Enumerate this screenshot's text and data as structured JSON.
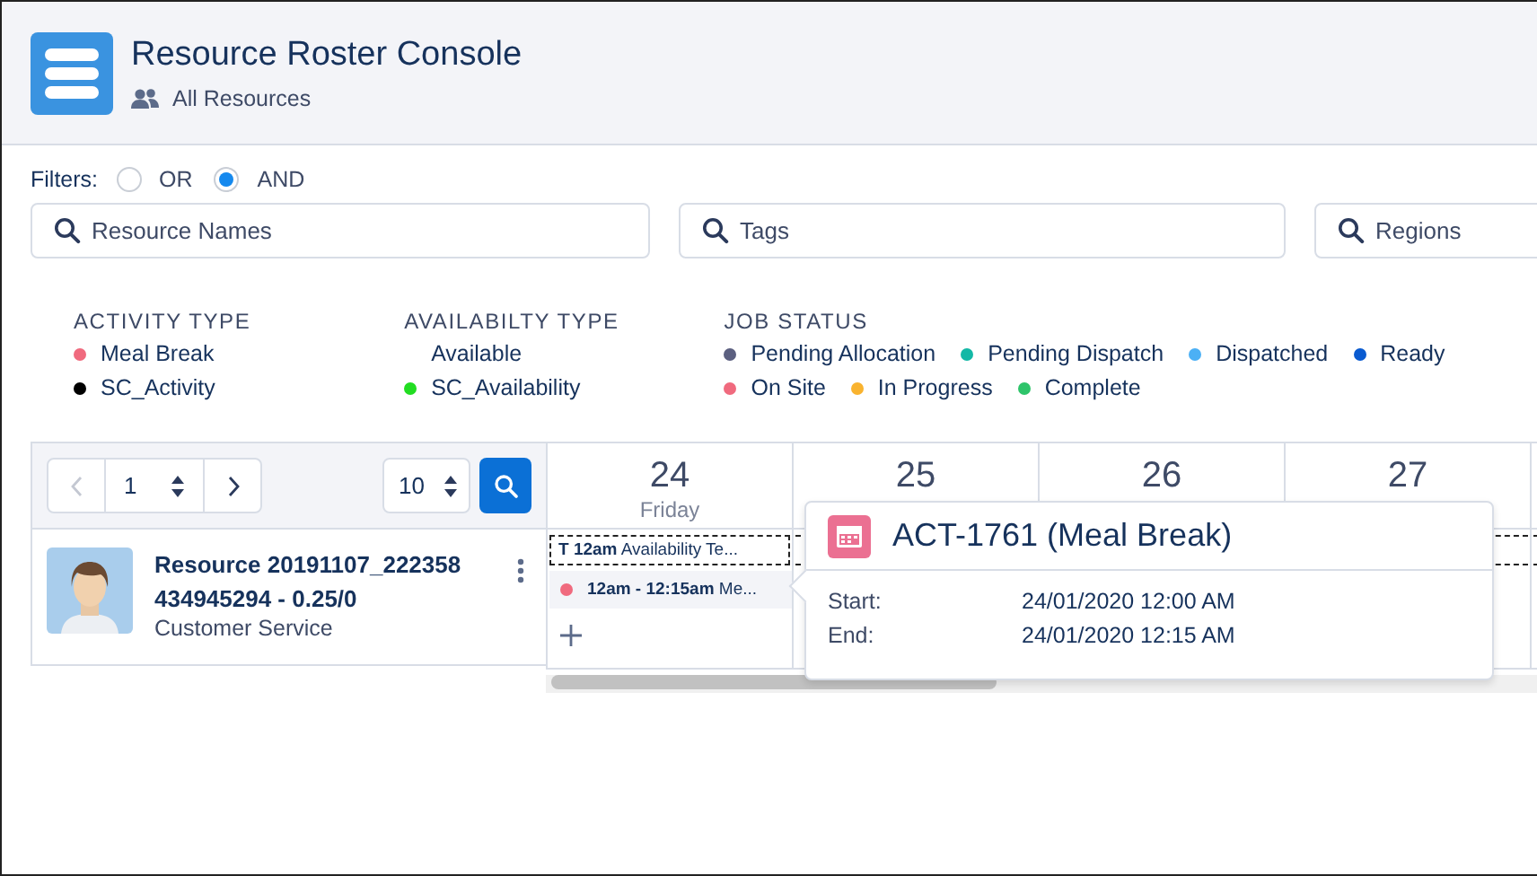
{
  "header": {
    "title": "Resource Roster Console",
    "subtitle": "All Resources"
  },
  "filters": {
    "label": "Filters:",
    "options": [
      {
        "label": "OR",
        "selected": false
      },
      {
        "label": "AND",
        "selected": true
      }
    ],
    "search_fields": [
      {
        "placeholder": "Resource Names"
      },
      {
        "placeholder": "Tags"
      },
      {
        "placeholder": "Regions"
      }
    ]
  },
  "legend": [
    {
      "heading": "ACTIVITY TYPE",
      "items": [
        {
          "label": "Meal Break",
          "color": "#f06a7e"
        },
        {
          "label": "SC_Activity",
          "color": "#000000"
        }
      ]
    },
    {
      "heading": "AVAILABILTY TYPE",
      "items": [
        {
          "label": "Available"
        },
        {
          "label": "SC_Availability",
          "color": "#22dd22"
        }
      ]
    },
    {
      "heading": "JOB STATUS",
      "items": [
        {
          "label": "Pending Allocation",
          "color": "#5c6080"
        },
        {
          "label": "Pending Dispatch",
          "color": "#14b8a6"
        },
        {
          "label": "Dispatched",
          "color": "#4cb0f5"
        },
        {
          "label": "Ready",
          "color": "#0a5bd0"
        },
        {
          "label": "On Site",
          "color": "#f06a7e"
        },
        {
          "label": "In Progress",
          "color": "#f9b32f"
        },
        {
          "label": "Complete",
          "color": "#2ec46a"
        }
      ]
    }
  ],
  "pager": {
    "page": "1",
    "page_size": "10"
  },
  "days": [
    {
      "number": "24",
      "name": "Friday"
    },
    {
      "number": "25"
    },
    {
      "number": "26"
    },
    {
      "number": "27"
    }
  ],
  "resource": {
    "name": "Resource 20191107_222358 434945294 - 0.25/0",
    "role": "Customer Service",
    "availability": {
      "tag": "T",
      "time": "12am",
      "label": "Availability Te..."
    },
    "activity": {
      "time": "12am - 12:15am",
      "label": "Me...",
      "color": "#f06a7e"
    }
  },
  "tooltip": {
    "title": "ACT-1761 (Meal Break)",
    "rows": [
      {
        "label": "Start:",
        "value": "24/01/2020 12:00 AM"
      },
      {
        "label": "End:",
        "value": "24/01/2020 12:15 AM"
      }
    ]
  }
}
